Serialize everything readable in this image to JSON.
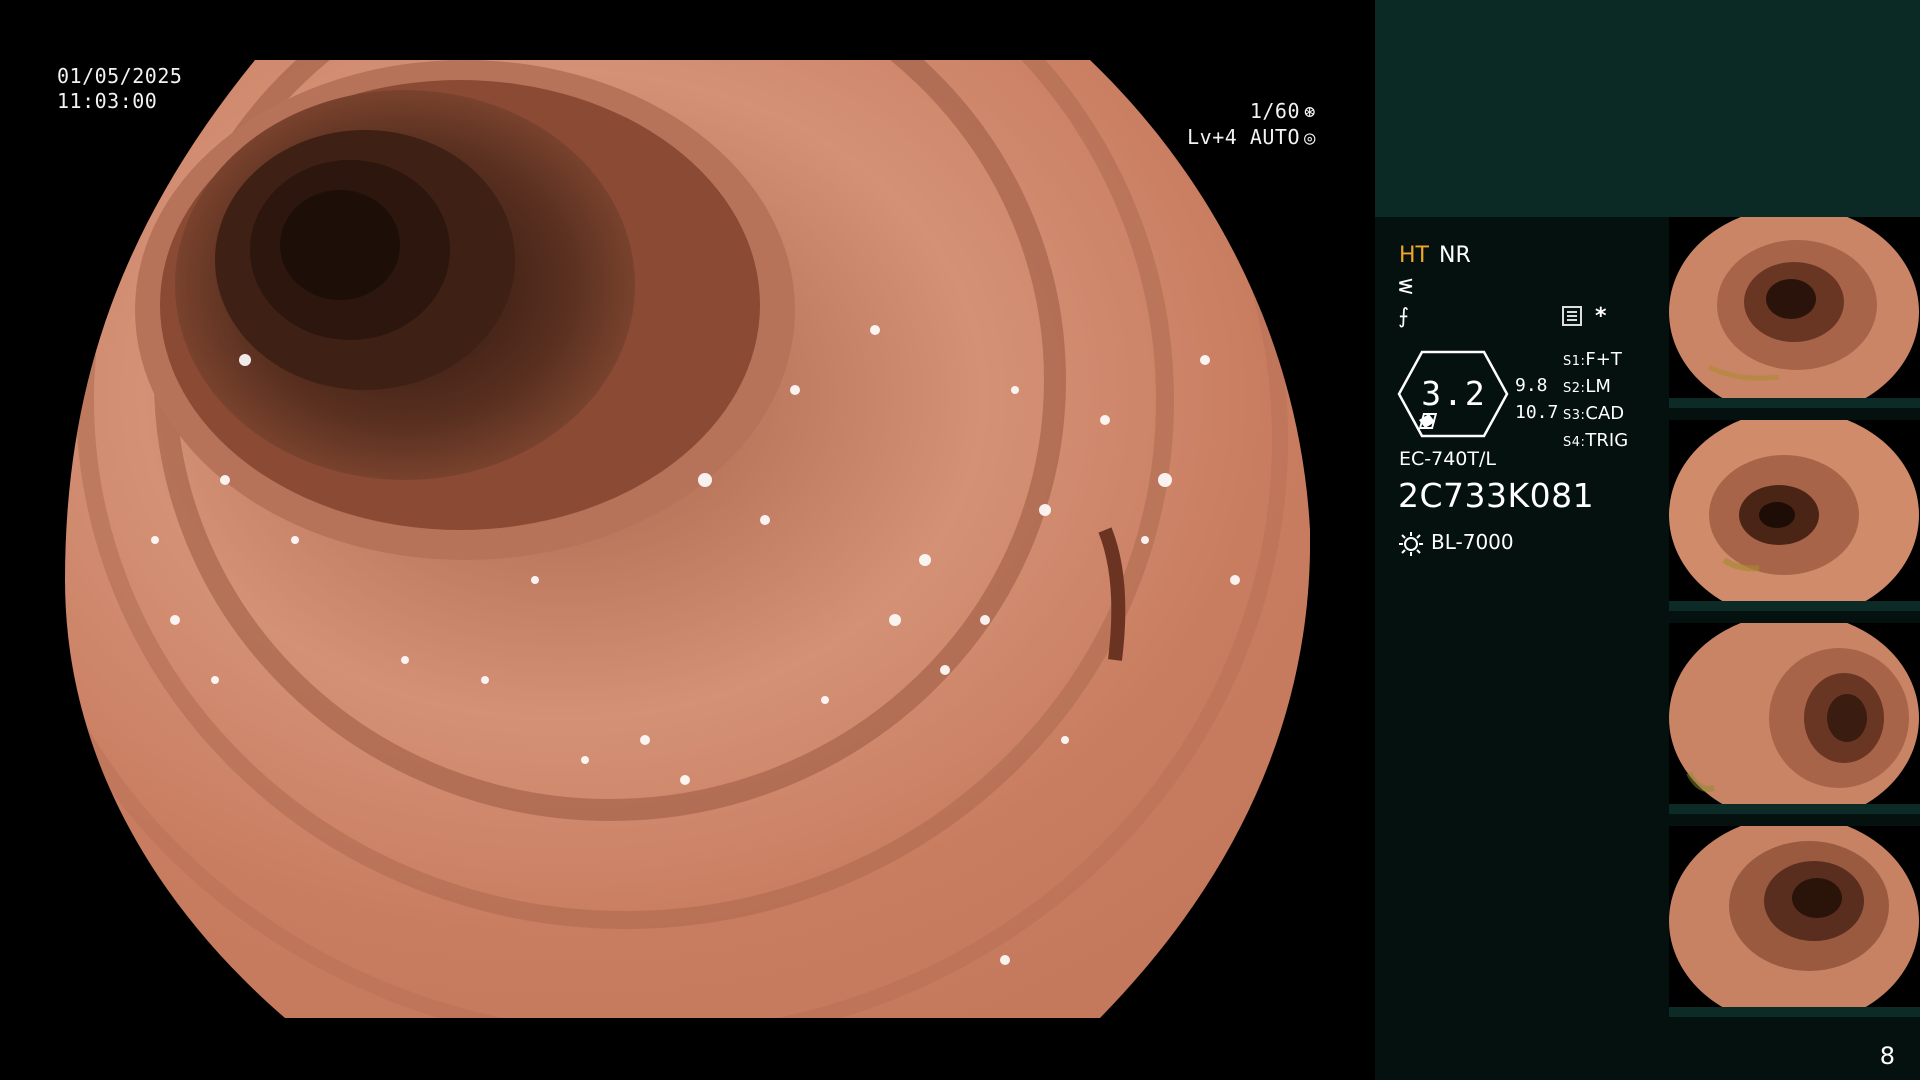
{
  "main": {
    "date": "01/05/2025",
    "time": "11:03:00",
    "shutter": "1/60",
    "shutter_icon": "aperture-icon",
    "iris_level": "Lv+4 AUTO",
    "iris_icon": "iris-icon",
    "scene": "endoscopic view of colon lumen with haustral folds"
  },
  "info": {
    "mode_ht": "HT",
    "mode_nr": "NR",
    "mode_ht_color": "#f3a52a",
    "filter_icon_1": "ᓬ",
    "filter_icon_2": "⨍",
    "menu_icon": "menu-icon",
    "asterisk": "*",
    "zoom_value": "3.2",
    "scale_top": "9.8",
    "scale_bottom": "10.7",
    "switches": [
      {
        "key": "S1:",
        "value": "F+T"
      },
      {
        "key": "S2:",
        "value": "LM"
      },
      {
        "key": "S3:",
        "value": "CAD"
      },
      {
        "key": "S4:",
        "value": "TRIG"
      }
    ],
    "scope_model": "EC-740T/L",
    "scope_serial": "2C733K081",
    "light_icon": "sun-icon",
    "light_source": "BL-7000"
  },
  "thumbnails": [
    {
      "label": "captured-image-1"
    },
    {
      "label": "captured-image-2"
    },
    {
      "label": "captured-image-3"
    },
    {
      "label": "captured-image-4"
    }
  ],
  "page_number": "8",
  "colors": {
    "background": "#000000",
    "side_panel": "#04110f",
    "side_top": "#0b2925",
    "tissue": "#d38b68"
  }
}
